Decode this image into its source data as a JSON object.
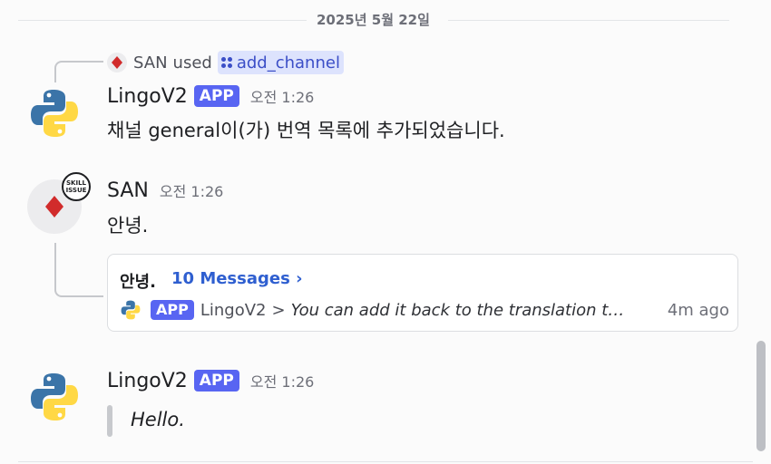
{
  "date_divider": {
    "label": "2025년 5월 22일"
  },
  "command": {
    "user": "SAN",
    "used_text": "used",
    "command_name": "add_channel"
  },
  "messages": [
    {
      "username": "LingoV2",
      "badge": "APP",
      "time": "오전 1:26",
      "text": "채널 general이(가) 번역 목록에 추가되었습니다.",
      "avatar_icon": "python-logo-icon"
    },
    {
      "username": "SAN",
      "time": "오전 1:26",
      "text": "안녕.",
      "avatar_icon": "red-diamond-icon",
      "avatar_decoration": {
        "line1": "SKILL",
        "line2": "ISSUE"
      }
    },
    {
      "username": "LingoV2",
      "badge": "APP",
      "time": "오전 1:26",
      "quote": "Hello.",
      "avatar_icon": "python-logo-icon"
    }
  ],
  "thread": {
    "title": "안녕.",
    "messages_link": "10 Messages ›",
    "badge": "APP",
    "author": "LingoV2",
    "separator": ">",
    "preview": "You can add it back to the translation t…",
    "ago": "4m ago"
  },
  "colors": {
    "app_badge": "#5865f2",
    "link": "#2f5fd0",
    "command_pill_bg": "#dde3fd",
    "diamond": "#d12b2b",
    "python_blue": "#3b74a8",
    "python_yellow": "#ffd845"
  }
}
